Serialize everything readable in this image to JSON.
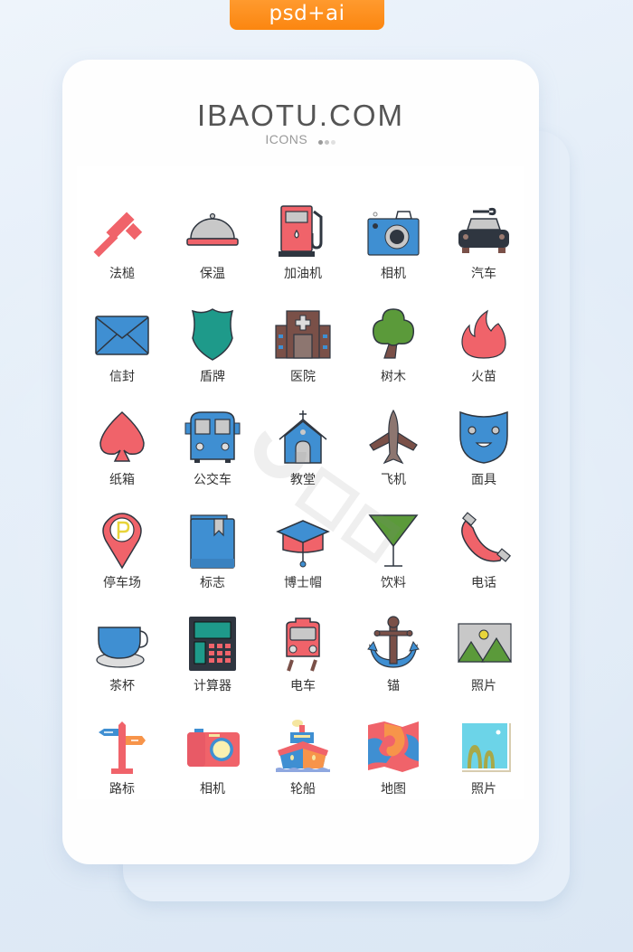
{
  "badge": {
    "label": "psd+ai"
  },
  "header": {
    "brand": "IBAOTU.COM",
    "subtitle": "ICONS",
    "dot_colors": [
      "#9a9a9a",
      "#c4c4c4",
      "#e0e0e0"
    ]
  },
  "colors": {
    "badge_orange": "#fb8a17",
    "red": "#f0636a",
    "blue": "#3f8fd2",
    "teal": "#1e9a8a",
    "green": "#5b9a3a",
    "brown": "#7a5048",
    "dark": "#2f3640",
    "gray": "#c8c8c8"
  },
  "icons": [
    {
      "name": "gavel",
      "label": "法槌"
    },
    {
      "name": "food-cover",
      "label": "保温"
    },
    {
      "name": "gas-pump",
      "label": "加油机"
    },
    {
      "name": "camera",
      "label": "相机"
    },
    {
      "name": "car",
      "label": "汽车"
    },
    {
      "name": "envelope",
      "label": "信封"
    },
    {
      "name": "shield",
      "label": "盾牌"
    },
    {
      "name": "hospital",
      "label": "医院"
    },
    {
      "name": "tree",
      "label": "树木"
    },
    {
      "name": "flame",
      "label": "火苗"
    },
    {
      "name": "spade",
      "label": "纸箱"
    },
    {
      "name": "bus",
      "label": "公交车"
    },
    {
      "name": "church",
      "label": "教堂"
    },
    {
      "name": "airplane",
      "label": "飞机"
    },
    {
      "name": "mask",
      "label": "面具"
    },
    {
      "name": "parking-pin",
      "label": "停车场"
    },
    {
      "name": "bookmark-book",
      "label": "标志"
    },
    {
      "name": "graduation-cap",
      "label": "博士帽"
    },
    {
      "name": "cocktail-glass",
      "label": "饮料"
    },
    {
      "name": "phone",
      "label": "电话"
    },
    {
      "name": "teacup",
      "label": "茶杯"
    },
    {
      "name": "calculator",
      "label": "计算器"
    },
    {
      "name": "tram",
      "label": "电车"
    },
    {
      "name": "anchor",
      "label": "锚"
    },
    {
      "name": "picture",
      "label": "照片"
    },
    {
      "name": "signpost",
      "label": "路标"
    },
    {
      "name": "camera-flat",
      "label": "相机"
    },
    {
      "name": "ship",
      "label": "轮船"
    },
    {
      "name": "map",
      "label": "地图"
    },
    {
      "name": "photo-flat",
      "label": "照片"
    }
  ]
}
